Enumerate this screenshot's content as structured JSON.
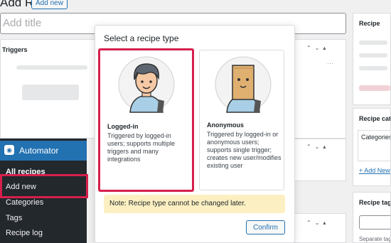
{
  "header": {
    "title": "Recipe",
    "add_new": "Add new"
  },
  "title_field": {
    "placeholder": "Add title"
  },
  "left_panel": {
    "heading": "Triggers"
  },
  "right": {
    "recipe_box": "Recipe",
    "categories_box": "Recipe categories",
    "categories_list": "Categories",
    "add_new_category": "+ Add New Category",
    "tags_box": "Recipe tags",
    "separate_tags": "Separate tags with commas"
  },
  "sidebar": {
    "title": "Automator",
    "items": [
      "All recipes",
      "Add new",
      "Categories",
      "Tags",
      "Recipe log"
    ]
  },
  "modal": {
    "title": "Select a recipe type",
    "options": [
      {
        "title": "Logged-in",
        "description": "Triggered by logged-in users; supports multiple triggers and many integrations"
      },
      {
        "title": "Anonymous",
        "description": "Triggered by logged-in or anonymous users; supports single trigger; creates new user/modifies existing user"
      }
    ],
    "note": "Note: Recipe type cannot be changed later.",
    "confirm": "Confirm"
  },
  "colors": {
    "accent": "#2271b1",
    "highlight": "#d61f4c",
    "note_bg": "#fcf0c3"
  }
}
